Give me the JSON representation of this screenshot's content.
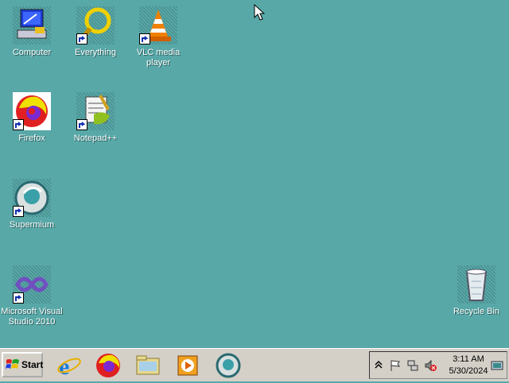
{
  "desktop": {
    "icons": [
      {
        "label": "Computer",
        "icon": "computer-icon"
      },
      {
        "label": "Everything",
        "icon": "everything-icon"
      },
      {
        "label": "VLC media player",
        "icon": "vlc-icon"
      },
      {
        "label": "Firefox",
        "icon": "firefox-icon"
      },
      {
        "label": "Notepad++",
        "icon": "notepadpp-icon"
      },
      {
        "label": "Supermium",
        "icon": "supermium-icon"
      },
      {
        "label": "Microsoft Visual Studio 2010",
        "icon": "visual-studio-icon"
      },
      {
        "label": "Recycle Bin",
        "icon": "recycle-bin-icon"
      }
    ]
  },
  "taskbar": {
    "start_label": "Start",
    "quick_launch": [
      "internet-explorer-icon",
      "firefox-icon",
      "explorer-icon",
      "media-player-icon",
      "supermium-icon"
    ],
    "tray_icons": [
      "chevron-up-icon",
      "flag-icon",
      "network-icon",
      "volume-muted-icon",
      "show-desktop-icon"
    ],
    "clock": {
      "time": "3:11 AM",
      "date": "5/30/2024"
    }
  },
  "colors": {
    "desktop": "#58a8a8",
    "taskbar": "#d4d0c8"
  }
}
